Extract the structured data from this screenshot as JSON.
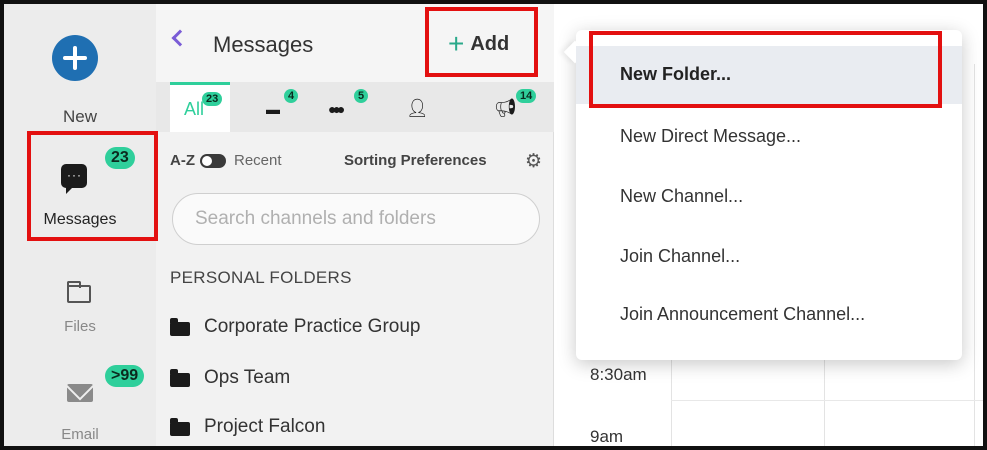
{
  "rail": {
    "new_label": "New",
    "messages_label": "Messages",
    "messages_badge": "23",
    "files_label": "Files",
    "email_label": "Email",
    "email_badge": ">99"
  },
  "panel": {
    "title": "Messages",
    "add_label": "Add",
    "tabs": [
      {
        "label": "All",
        "badge": "23",
        "icon": "all"
      },
      {
        "label": "",
        "badge": "4",
        "icon": "folder-icon"
      },
      {
        "label": "",
        "badge": "5",
        "icon": "group-icon"
      },
      {
        "label": "",
        "badge": "",
        "icon": "person-icon"
      },
      {
        "label": "",
        "badge": "14",
        "icon": "megaphone-icon"
      }
    ],
    "sort": {
      "az": "A-Z",
      "recent": "Recent",
      "preferences": "Sorting Preferences"
    },
    "search_placeholder": "Search channels and folders",
    "section_title": "PERSONAL FOLDERS",
    "folders": [
      "Corporate Practice Group",
      "Ops Team",
      "Project Falcon"
    ]
  },
  "calendar": {
    "times": [
      "8:30am",
      "9am"
    ]
  },
  "menu": {
    "items": [
      "New Folder...",
      "New Direct Message...",
      "New Channel...",
      "Join Channel...",
      "Join Announcement Channel..."
    ]
  },
  "colors": {
    "accent": "#2fcf9b",
    "new_button": "#1f6fb2",
    "highlight_box": "#e31010",
    "back_chevron": "#7a5cd6"
  }
}
